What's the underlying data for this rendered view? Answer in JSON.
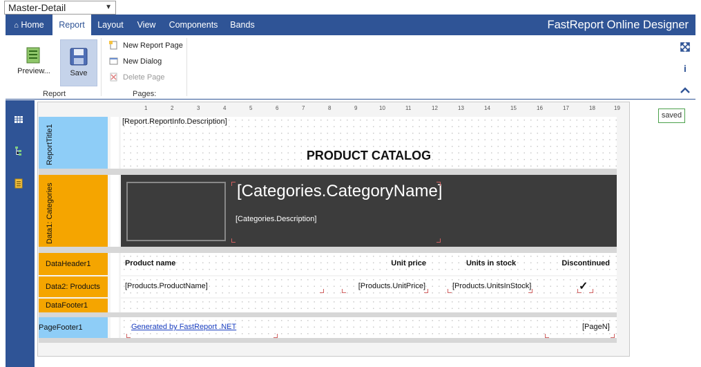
{
  "report_select": {
    "value": "Master-Detail"
  },
  "nav": {
    "tabs": [
      {
        "label": "Home"
      },
      {
        "label": "Report"
      },
      {
        "label": "Layout"
      },
      {
        "label": "View"
      },
      {
        "label": "Components"
      },
      {
        "label": "Bands"
      }
    ],
    "title": "FastReport Online Designer"
  },
  "ribbon": {
    "preview_label": "Preview...",
    "save_label": "Save",
    "report_group": "Report",
    "new_report_page": "New Report Page",
    "new_dialog": "New Dialog",
    "delete_page": "Delete Page",
    "pages_group": "Pages:"
  },
  "status": {
    "saved": "saved"
  },
  "ruler": [
    "1",
    "2",
    "3",
    "4",
    "5",
    "6",
    "7",
    "8",
    "9",
    "10",
    "11",
    "12",
    "13",
    "14",
    "15",
    "16",
    "17",
    "18",
    "19"
  ],
  "bands": {
    "report_title": "ReportTitle1",
    "data1": "Data1: Categories",
    "data_header": "DataHeader1",
    "data2": "Data2: Products",
    "data_footer": "DataFooter1",
    "page_footer": "PageFooter1"
  },
  "fields": {
    "report_description": "[Report.ReportInfo.Description]",
    "catalog_title": "PRODUCT CATALOG",
    "category_name": "[Categories.CategoryName]",
    "category_description": "[Categories.Description]",
    "col_product_name": "Product name",
    "col_unit_price": "Unit price",
    "col_units_in_stock": "Units in stock",
    "col_discontinued": "Discontinued",
    "product_name": "[Products.ProductName]",
    "unit_price": "[Products.UnitPrice]",
    "units_in_stock": "[Products.UnitsInStock]",
    "discontinued_check": "✓",
    "generated_by": "Generated by FastReport .NET",
    "page_n": "[PageN]"
  },
  "colors": {
    "nav": "#2f5496",
    "band_blue": "#8ecdf7",
    "band_orange": "#f5a500",
    "category_bg": "#3c3c3c"
  }
}
